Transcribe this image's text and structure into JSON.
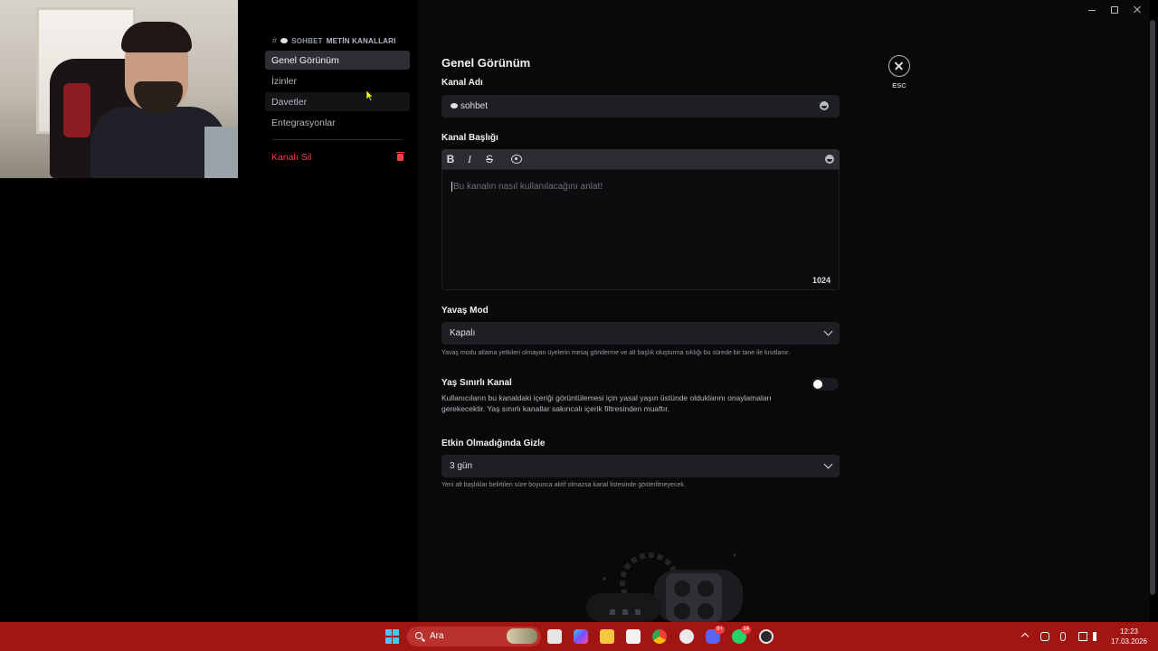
{
  "sidebar": {
    "category_prefix": "#",
    "category_channel": "SOHBET",
    "category_label": "METİN KANALLARI",
    "items": [
      {
        "label": "Genel Görünüm",
        "active": true
      },
      {
        "label": "İzinler"
      },
      {
        "label": "Davetler"
      },
      {
        "label": "Entegrasyonlar"
      }
    ],
    "delete_label": "Kanalı Sil"
  },
  "main": {
    "title": "Genel Görünüm",
    "channel_name": {
      "label": "Kanal Adı",
      "value": "sohbet"
    },
    "topic": {
      "label": "Kanal Başlığı",
      "placeholder": "Bu kanalın nasıl kullanılacağını anlat!",
      "char_count": "1024",
      "toolbar": {
        "bold": "B",
        "italic": "I",
        "strike": "S"
      }
    },
    "slowmode": {
      "label": "Yavaş Mod",
      "value": "Kapalı",
      "help": "Yavaş modu atlama yetkileri olmayan üyelerin mesaj gönderme ve alt başlık oluşturma sıklığı bu sürede bir tane ile kısıtlanır."
    },
    "age_restricted": {
      "label": "Yaş Sınırlı Kanal",
      "description": "Kullanıcıların bu kanaldaki içeriği görüntülemesi için yasal yaşın üstünde olduklarını onaylamaları gerekecektir. Yaş sınırlı kanallar sakıncalı içerik filtresinden muaftır.",
      "enabled": false
    },
    "hide_after_inactivity": {
      "label": "Etkin Olmadığında Gizle",
      "value": "3 gün",
      "help": "Yeni alt başlıklar belirtilen süre boyunca aktif olmazsa kanal listesinde gösterilmeyecek."
    },
    "close": {
      "label": "ESC"
    }
  },
  "taskbar": {
    "search_placeholder": "Ara",
    "discord_badge": "9+",
    "whatsapp_badge": "14",
    "time": "12:23",
    "date": "17.03.2026"
  },
  "colors": {
    "accent_danger": "#f23f43",
    "taskbar": "#a11613",
    "field_bg": "#1e1f22"
  }
}
